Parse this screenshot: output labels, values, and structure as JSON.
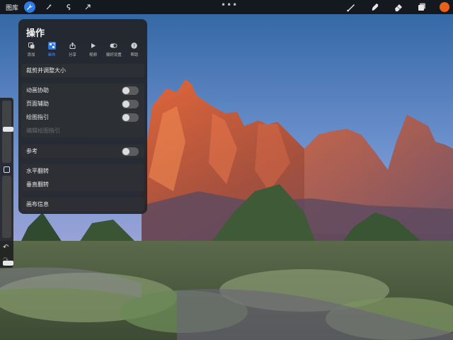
{
  "topbar": {
    "gallery": "图库",
    "tools": [
      {
        "name": "wrench-icon",
        "active": true
      },
      {
        "name": "magic-wand-icon",
        "active": false
      },
      {
        "name": "selection-icon",
        "active": false
      },
      {
        "name": "transform-arrow-icon",
        "active": false
      }
    ],
    "more": "•••",
    "right_tools": [
      "brush-icon",
      "smudge-icon",
      "eraser-icon",
      "layers-icon"
    ],
    "current_color": "#e8601c"
  },
  "panel": {
    "title": "操作",
    "tabs": [
      {
        "label": "添加",
        "icon": "add-icon"
      },
      {
        "label": "画布",
        "icon": "canvas-icon",
        "active": true
      },
      {
        "label": "分享",
        "icon": "share-icon"
      },
      {
        "label": "视频",
        "icon": "video-icon"
      },
      {
        "label": "偏好设置",
        "icon": "prefs-toggle-icon"
      },
      {
        "label": "帮助",
        "icon": "help-icon"
      }
    ],
    "crop": "裁剪并调整大小",
    "guides": {
      "animation_assist": "动画协助",
      "page_assist": "页面辅助",
      "drawing_guide": "绘图指引",
      "edit_drawing_guide": "编辑绘图指引"
    },
    "reference": "参考",
    "flip_horizontal": "水平翻转",
    "flip_vertical": "垂直翻转",
    "canvas_info": "画布信息"
  },
  "colors": {
    "accent": "#2f7be4",
    "panel_bg": "#222428",
    "sky_top": "#3a6ea8",
    "sky_bottom": "#c9b6e0"
  }
}
